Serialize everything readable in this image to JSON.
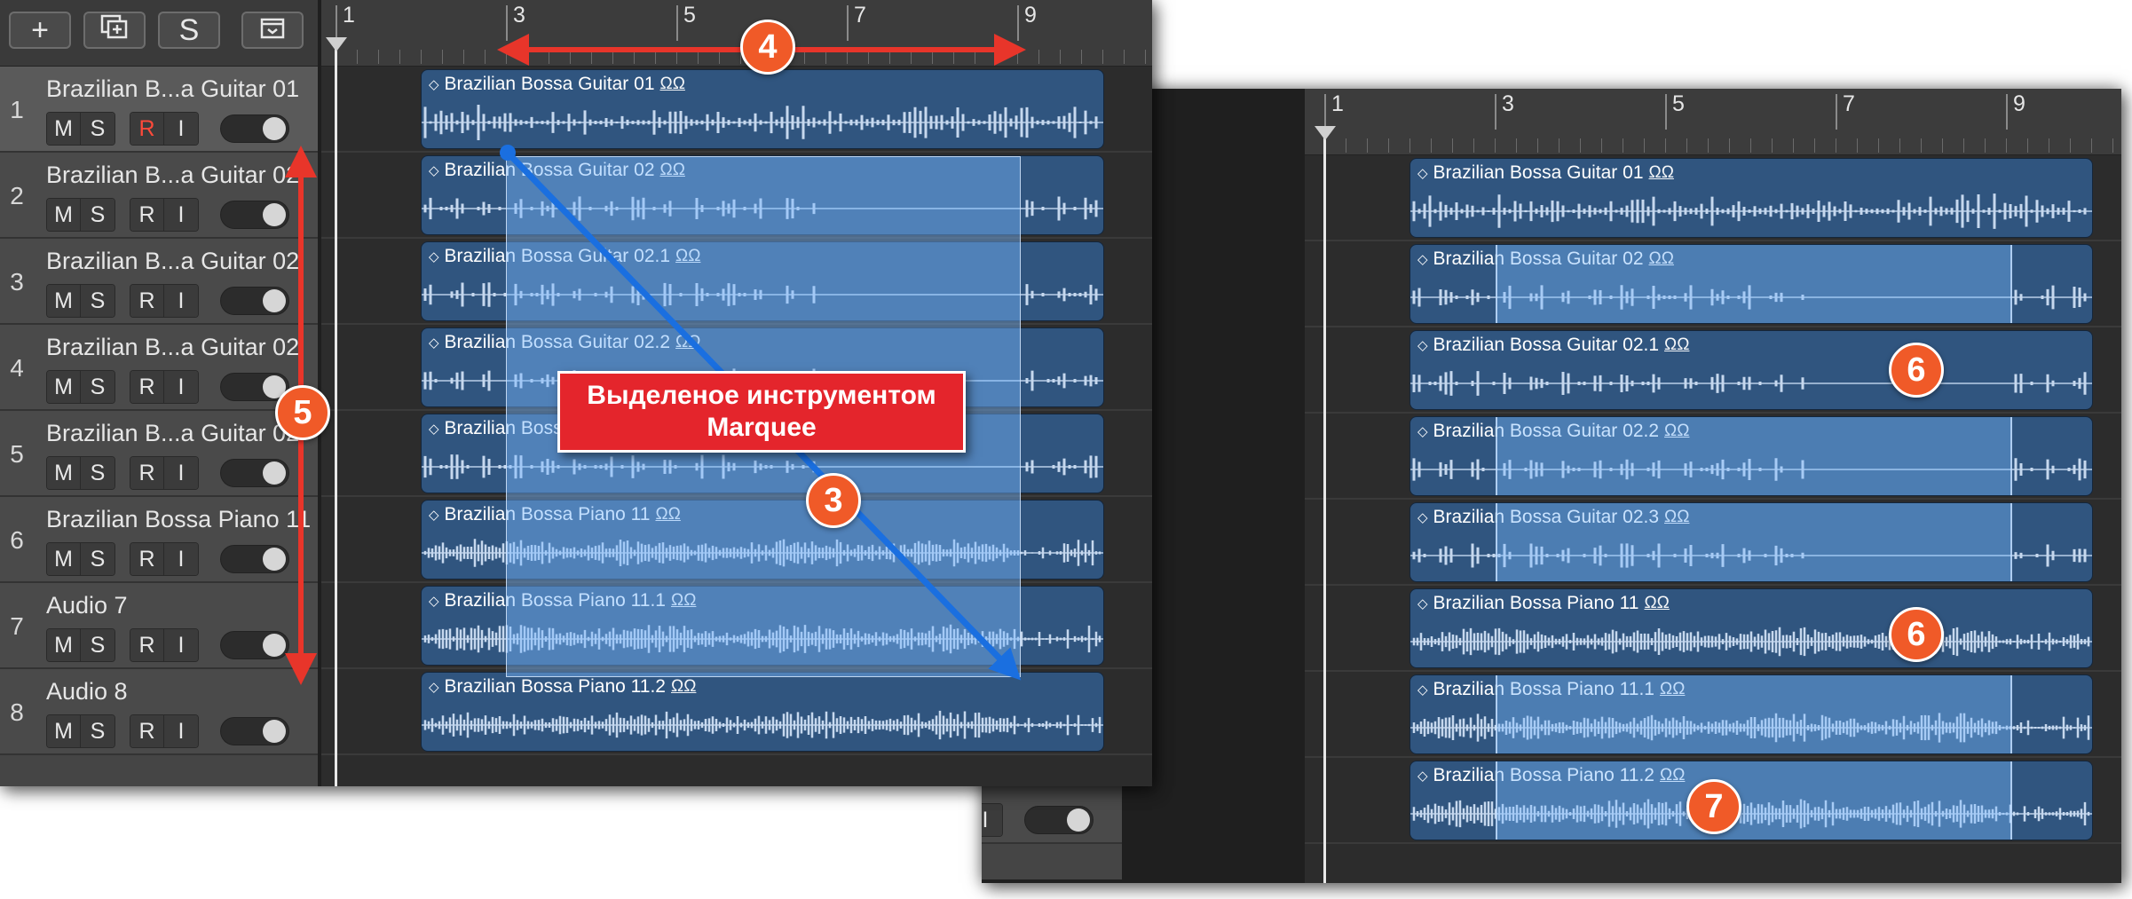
{
  "annotation": {
    "callout_text": "Выделеное инструментом Marquee",
    "badges": [
      "3",
      "4",
      "5",
      "6",
      "6",
      "7"
    ]
  },
  "toolbar": {
    "add_label": "+",
    "solo_label": "S"
  },
  "ruler": {
    "bars": [
      "1",
      "3",
      "5",
      "7",
      "9"
    ]
  },
  "track_buttons": {
    "mute": "M",
    "solo": "S",
    "record": "R",
    "input": "I"
  },
  "left": {
    "tracks": [
      {
        "number": "1",
        "name": "Brazilian B...a Guitar 01"
      },
      {
        "number": "2",
        "name": "Brazilian B...a Guitar 02"
      },
      {
        "number": "3",
        "name": "Brazilian B...a Guitar 02"
      },
      {
        "number": "4",
        "name": "Brazilian B...a Guitar 02"
      },
      {
        "number": "5",
        "name": "Brazilian B...a Guitar 02"
      },
      {
        "number": "6",
        "name": "Brazilian Bossa Piano 11"
      },
      {
        "number": "7",
        "name": "Audio 7"
      },
      {
        "number": "8",
        "name": "Audio 8"
      }
    ],
    "regions": [
      {
        "name": "Brazilian Bossa Guitar 01"
      },
      {
        "name": "Brazilian Bossa Guitar 02"
      },
      {
        "name": "Brazilian Bossa Guitar 02.1"
      },
      {
        "name": "Brazilian Bossa Guitar 02.2"
      },
      {
        "name": "Brazilian Bossa Guitar 02.3"
      },
      {
        "name": "Brazilian Bossa Piano 11"
      },
      {
        "name": "Brazilian Bossa Piano 11.1"
      },
      {
        "name": "Brazilian Bossa Piano 11.2"
      }
    ]
  },
  "right": {
    "tracks": [
      {
        "number": "",
        "name": "..a Guitar 01"
      },
      {
        "number": "",
        "name": "..a Guitar 02"
      },
      {
        "number": "",
        "name": "..a Guitar 02"
      },
      {
        "number": "",
        "name": "..a Guitar 02"
      },
      {
        "number": "",
        "name": "..a Guitar 02"
      },
      {
        "number": "",
        "name": "ossa Piano 11"
      },
      {
        "number": "",
        "name": ""
      },
      {
        "number": "8",
        "name": "Audio 8"
      }
    ],
    "regions": [
      {
        "name": "Brazilian Bossa Guitar 01"
      },
      {
        "name": "Brazilian Bossa Guitar 02"
      },
      {
        "name": "Brazilian Bossa Guitar 02.1"
      },
      {
        "name": "Brazilian Bossa Guitar 02.2"
      },
      {
        "name": "Brazilian Bossa Guitar 02.3"
      },
      {
        "name": "Brazilian Bossa Piano 11"
      },
      {
        "name": "Brazilian Bossa Piano 11.1"
      },
      {
        "name": "Brazilian Bossa Piano 11.2"
      }
    ]
  },
  "colors": {
    "region": "#30557f",
    "selection": "#78b9ff",
    "annotation": "#f05a28",
    "arrow_red": "#e8352a",
    "arrow_blue": "#1a6fe0",
    "callout": "#e4252c"
  }
}
